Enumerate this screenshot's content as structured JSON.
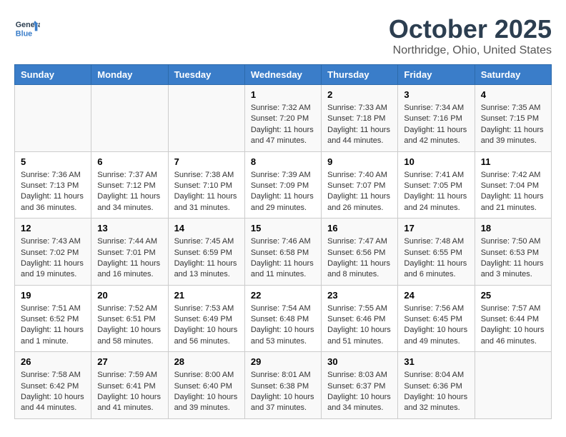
{
  "logo": {
    "line1": "General",
    "line2": "Blue"
  },
  "title": "October 2025",
  "location": "Northridge, Ohio, United States",
  "weekdays": [
    "Sunday",
    "Monday",
    "Tuesday",
    "Wednesday",
    "Thursday",
    "Friday",
    "Saturday"
  ],
  "weeks": [
    [
      {
        "day": "",
        "info": ""
      },
      {
        "day": "",
        "info": ""
      },
      {
        "day": "",
        "info": ""
      },
      {
        "day": "1",
        "info": "Sunrise: 7:32 AM\nSunset: 7:20 PM\nDaylight: 11 hours\nand 47 minutes."
      },
      {
        "day": "2",
        "info": "Sunrise: 7:33 AM\nSunset: 7:18 PM\nDaylight: 11 hours\nand 44 minutes."
      },
      {
        "day": "3",
        "info": "Sunrise: 7:34 AM\nSunset: 7:16 PM\nDaylight: 11 hours\nand 42 minutes."
      },
      {
        "day": "4",
        "info": "Sunrise: 7:35 AM\nSunset: 7:15 PM\nDaylight: 11 hours\nand 39 minutes."
      }
    ],
    [
      {
        "day": "5",
        "info": "Sunrise: 7:36 AM\nSunset: 7:13 PM\nDaylight: 11 hours\nand 36 minutes."
      },
      {
        "day": "6",
        "info": "Sunrise: 7:37 AM\nSunset: 7:12 PM\nDaylight: 11 hours\nand 34 minutes."
      },
      {
        "day": "7",
        "info": "Sunrise: 7:38 AM\nSunset: 7:10 PM\nDaylight: 11 hours\nand 31 minutes."
      },
      {
        "day": "8",
        "info": "Sunrise: 7:39 AM\nSunset: 7:09 PM\nDaylight: 11 hours\nand 29 minutes."
      },
      {
        "day": "9",
        "info": "Sunrise: 7:40 AM\nSunset: 7:07 PM\nDaylight: 11 hours\nand 26 minutes."
      },
      {
        "day": "10",
        "info": "Sunrise: 7:41 AM\nSunset: 7:05 PM\nDaylight: 11 hours\nand 24 minutes."
      },
      {
        "day": "11",
        "info": "Sunrise: 7:42 AM\nSunset: 7:04 PM\nDaylight: 11 hours\nand 21 minutes."
      }
    ],
    [
      {
        "day": "12",
        "info": "Sunrise: 7:43 AM\nSunset: 7:02 PM\nDaylight: 11 hours\nand 19 minutes."
      },
      {
        "day": "13",
        "info": "Sunrise: 7:44 AM\nSunset: 7:01 PM\nDaylight: 11 hours\nand 16 minutes."
      },
      {
        "day": "14",
        "info": "Sunrise: 7:45 AM\nSunset: 6:59 PM\nDaylight: 11 hours\nand 13 minutes."
      },
      {
        "day": "15",
        "info": "Sunrise: 7:46 AM\nSunset: 6:58 PM\nDaylight: 11 hours\nand 11 minutes."
      },
      {
        "day": "16",
        "info": "Sunrise: 7:47 AM\nSunset: 6:56 PM\nDaylight: 11 hours\nand 8 minutes."
      },
      {
        "day": "17",
        "info": "Sunrise: 7:48 AM\nSunset: 6:55 PM\nDaylight: 11 hours\nand 6 minutes."
      },
      {
        "day": "18",
        "info": "Sunrise: 7:50 AM\nSunset: 6:53 PM\nDaylight: 11 hours\nand 3 minutes."
      }
    ],
    [
      {
        "day": "19",
        "info": "Sunrise: 7:51 AM\nSunset: 6:52 PM\nDaylight: 11 hours\nand 1 minute."
      },
      {
        "day": "20",
        "info": "Sunrise: 7:52 AM\nSunset: 6:51 PM\nDaylight: 10 hours\nand 58 minutes."
      },
      {
        "day": "21",
        "info": "Sunrise: 7:53 AM\nSunset: 6:49 PM\nDaylight: 10 hours\nand 56 minutes."
      },
      {
        "day": "22",
        "info": "Sunrise: 7:54 AM\nSunset: 6:48 PM\nDaylight: 10 hours\nand 53 minutes."
      },
      {
        "day": "23",
        "info": "Sunrise: 7:55 AM\nSunset: 6:46 PM\nDaylight: 10 hours\nand 51 minutes."
      },
      {
        "day": "24",
        "info": "Sunrise: 7:56 AM\nSunset: 6:45 PM\nDaylight: 10 hours\nand 49 minutes."
      },
      {
        "day": "25",
        "info": "Sunrise: 7:57 AM\nSunset: 6:44 PM\nDaylight: 10 hours\nand 46 minutes."
      }
    ],
    [
      {
        "day": "26",
        "info": "Sunrise: 7:58 AM\nSunset: 6:42 PM\nDaylight: 10 hours\nand 44 minutes."
      },
      {
        "day": "27",
        "info": "Sunrise: 7:59 AM\nSunset: 6:41 PM\nDaylight: 10 hours\nand 41 minutes."
      },
      {
        "day": "28",
        "info": "Sunrise: 8:00 AM\nSunset: 6:40 PM\nDaylight: 10 hours\nand 39 minutes."
      },
      {
        "day": "29",
        "info": "Sunrise: 8:01 AM\nSunset: 6:38 PM\nDaylight: 10 hours\nand 37 minutes."
      },
      {
        "day": "30",
        "info": "Sunrise: 8:03 AM\nSunset: 6:37 PM\nDaylight: 10 hours\nand 34 minutes."
      },
      {
        "day": "31",
        "info": "Sunrise: 8:04 AM\nSunset: 6:36 PM\nDaylight: 10 hours\nand 32 minutes."
      },
      {
        "day": "",
        "info": ""
      }
    ]
  ]
}
